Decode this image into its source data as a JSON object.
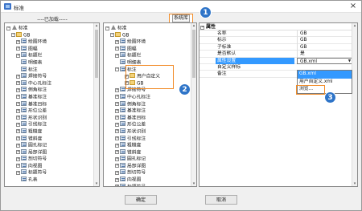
{
  "window": {
    "title": "标准",
    "close_symbol": "×"
  },
  "header": {
    "loaded_label": "----已加载-----",
    "system_button": "系统库"
  },
  "left_tree": {
    "root_label": "标准",
    "gb_label": "GB",
    "items": [
      "绘图环境",
      "图幅",
      "标题栏",
      "明细表",
      "标注",
      "焊接符号",
      "中心孔标注",
      "倒角标注",
      "基准标注",
      "基准目标",
      "形位公差",
      "形状识别",
      "引线标注",
      "粗糙度",
      "锥斜度",
      "圆孔标记",
      "局部详图",
      "剖切符号",
      "向视图",
      "标题符号",
      "孔表"
    ]
  },
  "mid_tree": {
    "root_label": "标准",
    "gb_label": "GB",
    "items_top": [
      "绘图环境",
      "图幅",
      "标题栏",
      "明细表"
    ],
    "biaozhu_label": "标注",
    "sub_items": [
      "用户自定义",
      "GB"
    ],
    "items_bottom": [
      "焊接符号",
      "中心孔标注",
      "倒角标注",
      "基准标注",
      "基准目标",
      "形位公差",
      "形状识别",
      "引线标注",
      "粗糙度",
      "锥斜度",
      "圆孔标记",
      "局部详图",
      "剖切符号",
      "向视图",
      "标题符号",
      "孔表"
    ]
  },
  "property_grid": {
    "section": "属性",
    "rows": [
      {
        "key": "名称",
        "value": "GB"
      },
      {
        "key": "标示",
        "value": "GB"
      },
      {
        "key": "子标准",
        "value": "GB"
      },
      {
        "key": "是否默认",
        "value": "是"
      },
      {
        "key": "属性设置",
        "value": "GB.xml"
      },
      {
        "key": "自定义样标",
        "value": ""
      },
      {
        "key": "备注",
        "value": ""
      }
    ],
    "dropdown_options": [
      "GB.xml",
      "用户自定义.xml",
      "浏览..."
    ]
  },
  "markers": [
    "1",
    "2",
    "3"
  ],
  "footer": {
    "ok_label": "确定",
    "cancel_label": "取消"
  },
  "colors": {
    "accent_orange": "#f28c28",
    "marker_blue": "#2e74c8",
    "selection_blue": "#3399ff"
  }
}
